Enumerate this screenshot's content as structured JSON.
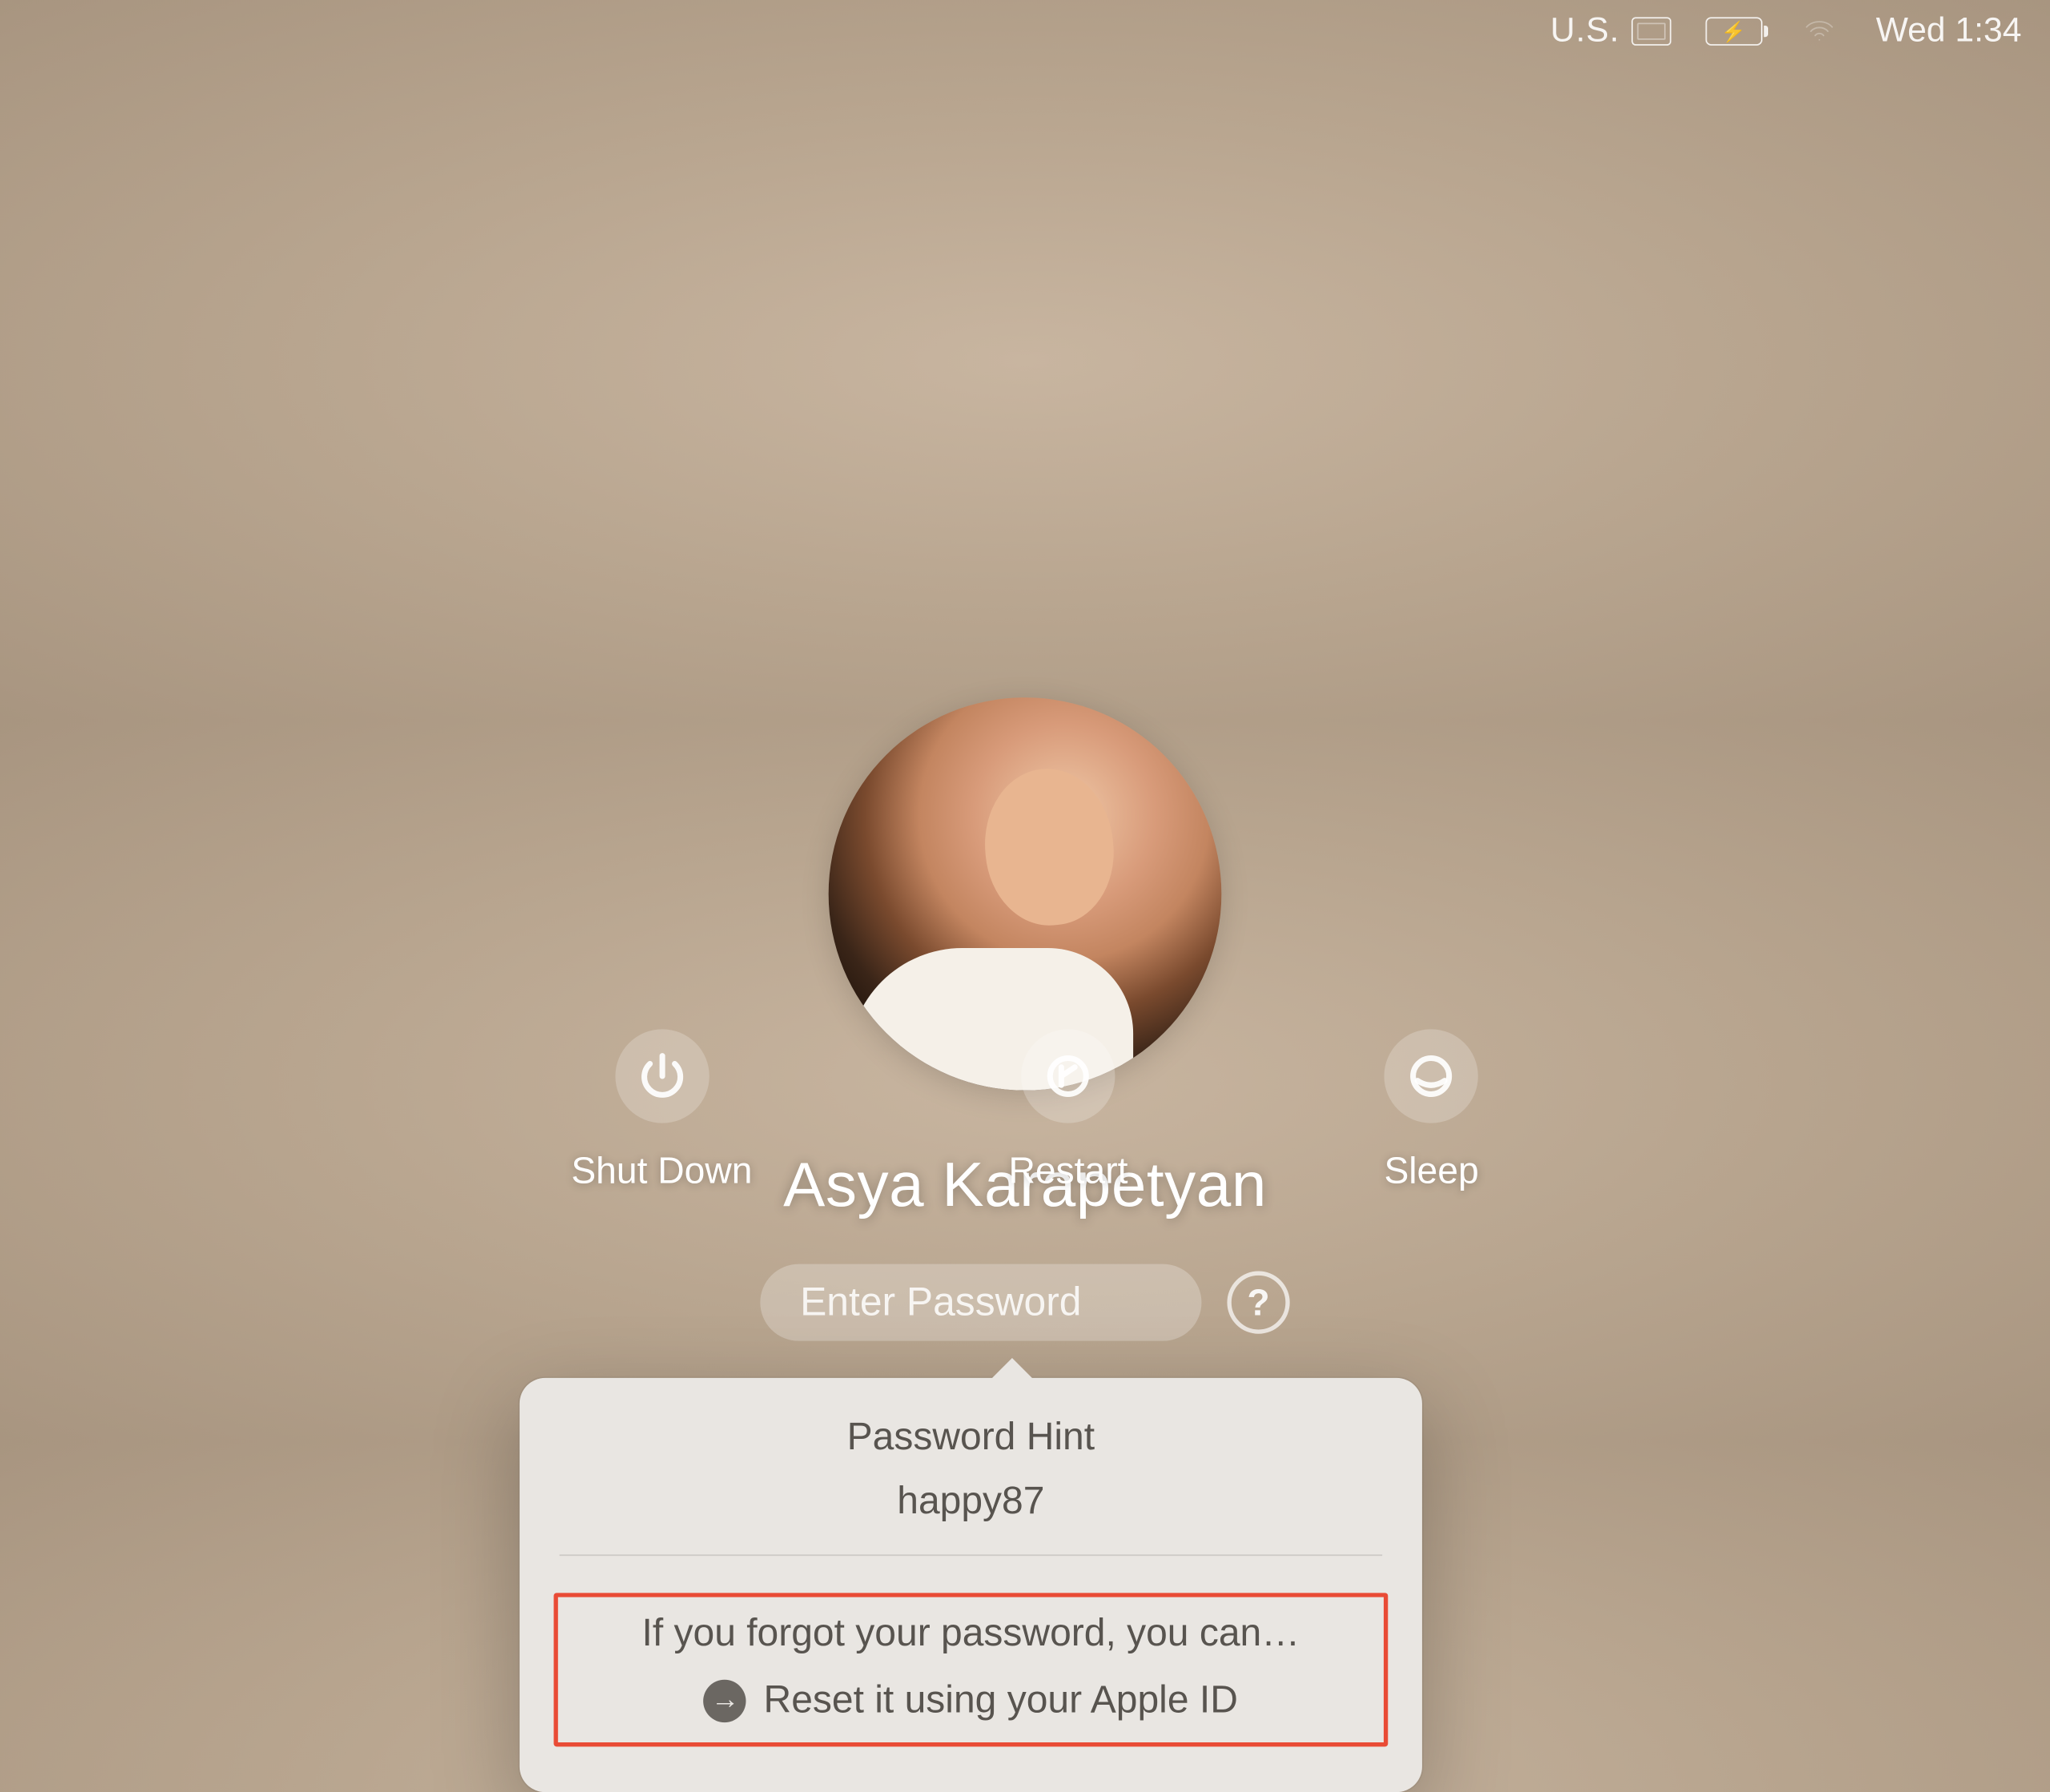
{
  "menubar": {
    "input_source": "U.S.",
    "datetime": "Wed 1:34"
  },
  "login": {
    "username": "Asya Karapetyan",
    "password_placeholder": "Enter Password",
    "hint_glyph": "?"
  },
  "popover": {
    "title": "Password Hint",
    "hint_value": "happy87",
    "forgot_text": "If you forgot your password, you can…",
    "reset_text": "Reset it using your Apple ID",
    "arrow_glyph": "→"
  },
  "power": {
    "shutdown": "Shut Down",
    "restart": "Restart",
    "sleep": "Sleep"
  }
}
